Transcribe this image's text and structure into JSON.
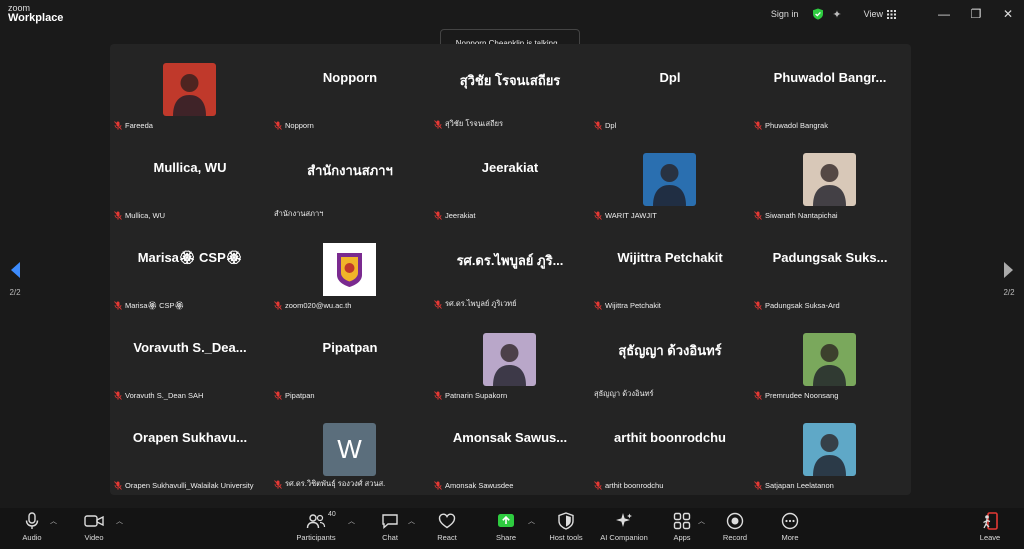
{
  "titlebar": {
    "logo_top": "zoom",
    "logo_bottom": "Workplace",
    "sign_in": "Sign in",
    "view": "View"
  },
  "toast": "Nopporn Cheanklin is talking...",
  "nav": {
    "prev_page": "2/2",
    "next_page": "2/2"
  },
  "tiles": [
    {
      "name": "",
      "label": "Fareeda",
      "photo": "#c0392b"
    },
    {
      "name": "Nopporn",
      "label": "Nopporn"
    },
    {
      "name": "สุวิชัย โรจนเสถียร",
      "label": "สุวิชัย โรจนเสถียร"
    },
    {
      "name": "Dpl",
      "label": "Dpl"
    },
    {
      "name": "Phuwadol  Bangr...",
      "label": "Phuwadol Bangrak"
    },
    {
      "name": "Mullica, WU",
      "label": "Mullica, WU"
    },
    {
      "name": "สำนักงานสภาฯ",
      "label": "สำนักงานสภาฯ",
      "nomic": true
    },
    {
      "name": "Jeerakiat",
      "label": "Jeerakiat"
    },
    {
      "name": "",
      "label": "WARIT JAWJIT",
      "photo": "#2a6fb0"
    },
    {
      "name": "",
      "label": "Siwanath Nantapichai",
      "photo": "#d8c8b8"
    },
    {
      "name": "Marisa🏵 CSP🏵",
      "label": "Marisa🏵 CSP🏵"
    },
    {
      "name": "",
      "label": "zoom020@wu.ac.th",
      "photo": "#ffffff",
      "logo": true
    },
    {
      "name": "รศ.ดร.ไพบูลย์ ภูริ...",
      "label": "รศ.ดร.ไพบูลย์ ภูริเวทย์"
    },
    {
      "name": "Wijittra Petchakit",
      "label": "Wijittra Petchakit"
    },
    {
      "name": "Padungsak  Suks...",
      "label": "Padungsak Suksa-Ard"
    },
    {
      "name": "Voravuth  S._Dea...",
      "label": "Voravuth S._Dean SAH"
    },
    {
      "name": "Pipatpan",
      "label": "Pipatpan"
    },
    {
      "name": "",
      "label": "Patnarin Supakorn",
      "photo": "#b9a7c9"
    },
    {
      "name": "สุธัญญา ด้วงอินทร์",
      "label": "สุธัญญา ด้วงอินทร์",
      "nomic": true
    },
    {
      "name": "",
      "label": "Premrudee Noonsang",
      "photo": "#7aa85c"
    },
    {
      "name": "Orapen  Sukhavu...",
      "label": "Orapen Sukhavulli_Walailak University"
    },
    {
      "name": "",
      "label": "รศ.ดร.วิชิตพันธุ์ รองวงศ์ สวนส.",
      "photo": "#5b6e7c",
      "letter": "W"
    },
    {
      "name": "Amonsak  Sawus...",
      "label": "Amonsak Sawusdee"
    },
    {
      "name": "arthit boonrodchu",
      "label": "arthit boonrodchu"
    },
    {
      "name": "",
      "label": "Satjapan Leelatanon",
      "photo": "#5fa8c7"
    }
  ],
  "toolbar": {
    "audio": "Audio",
    "video": "Video",
    "participants": "Participants",
    "participants_count": "40",
    "chat": "Chat",
    "react": "React",
    "share": "Share",
    "host_tools": "Host tools",
    "ai_companion": "AI Companion",
    "apps": "Apps",
    "record": "Record",
    "more": "More",
    "leave": "Leave"
  }
}
